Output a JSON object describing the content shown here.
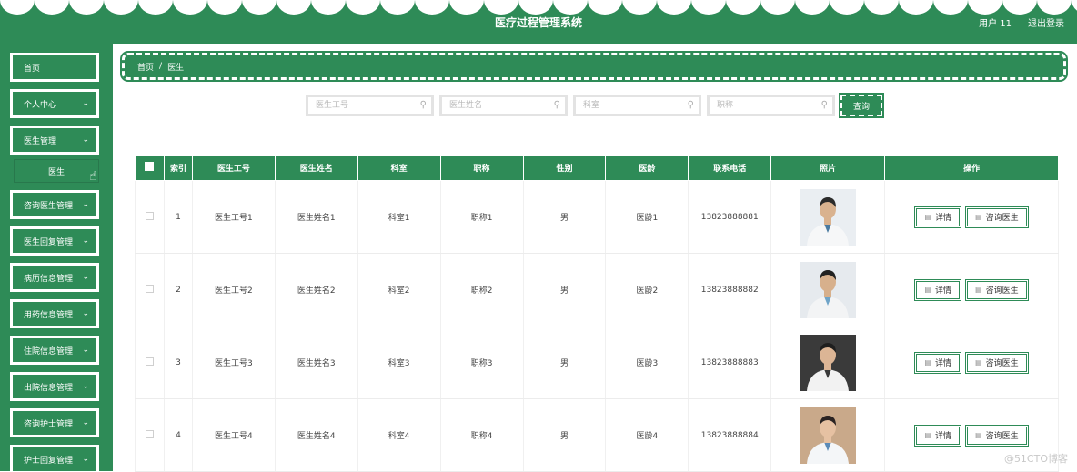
{
  "header": {
    "title": "医疗过程管理系统",
    "user": "用户 11",
    "logout": "退出登录"
  },
  "sidebar": {
    "items": [
      {
        "label": "首页",
        "chevron": false
      },
      {
        "label": "个人中心",
        "chevron": true
      },
      {
        "label": "医生管理",
        "chevron": true
      },
      {
        "label": "咨询医生管理",
        "chevron": true
      },
      {
        "label": "医生回复管理",
        "chevron": true
      },
      {
        "label": "病历信息管理",
        "chevron": true
      },
      {
        "label": "用药信息管理",
        "chevron": true
      },
      {
        "label": "住院信息管理",
        "chevron": true
      },
      {
        "label": "出院信息管理",
        "chevron": true
      },
      {
        "label": "咨询护士管理",
        "chevron": true
      },
      {
        "label": "护士回复管理",
        "chevron": true
      }
    ],
    "submenu": {
      "label": "医生"
    }
  },
  "breadcrumb": {
    "home": "首页",
    "sep": "/",
    "current": "医生"
  },
  "search": {
    "fields": [
      {
        "placeholder": "医生工号"
      },
      {
        "placeholder": "医生姓名"
      },
      {
        "placeholder": "科室"
      },
      {
        "placeholder": "职称"
      }
    ],
    "button": "查询"
  },
  "table": {
    "headers": [
      "索引",
      "医生工号",
      "医生姓名",
      "科室",
      "职称",
      "性别",
      "医龄",
      "联系电话",
      "照片",
      "操作"
    ],
    "rows": [
      {
        "index": "1",
        "id": "医生工号1",
        "name": "医生姓名1",
        "dept": "科室1",
        "title": "职称1",
        "gender": "男",
        "years": "医龄1",
        "phone": "13823888881"
      },
      {
        "index": "2",
        "id": "医生工号2",
        "name": "医生姓名2",
        "dept": "科室2",
        "title": "职称2",
        "gender": "男",
        "years": "医龄2",
        "phone": "13823888882"
      },
      {
        "index": "3",
        "id": "医生工号3",
        "name": "医生姓名3",
        "dept": "科室3",
        "title": "职称3",
        "gender": "男",
        "years": "医龄3",
        "phone": "13823888883"
      },
      {
        "index": "4",
        "id": "医生工号4",
        "name": "医生姓名4",
        "dept": "科室4",
        "title": "职称4",
        "gender": "男",
        "years": "医龄4",
        "phone": "13823888884"
      }
    ],
    "actions": {
      "detail": "详情",
      "consult": "咨询医生"
    }
  },
  "watermark": "@51CTO博客",
  "colors": {
    "primary": "#2e8b57",
    "white": "#ffffff"
  }
}
